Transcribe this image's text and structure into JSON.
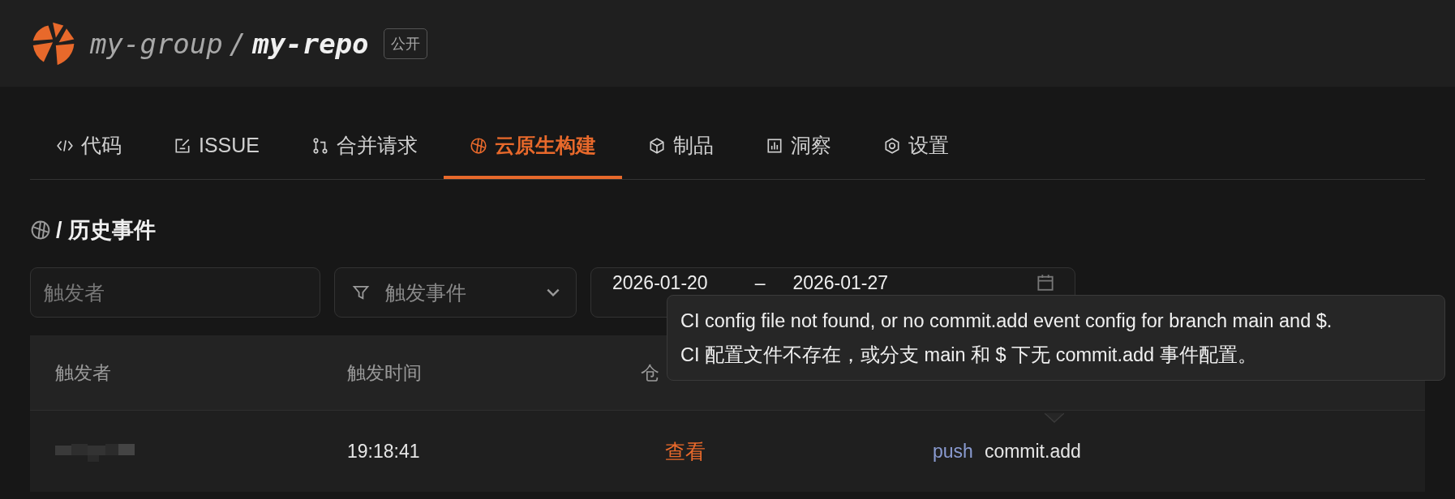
{
  "header": {
    "group": "my-group",
    "separator": "/",
    "repo": "my-repo",
    "visibility": "公开"
  },
  "tabs": [
    {
      "label": "代码",
      "selected": false
    },
    {
      "label": "ISSUE",
      "selected": false
    },
    {
      "label": "合并请求",
      "selected": false
    },
    {
      "label": "云原生构建",
      "selected": true
    },
    {
      "label": "制品",
      "selected": false
    },
    {
      "label": "洞察",
      "selected": false
    },
    {
      "label": "设置",
      "selected": false
    }
  ],
  "breadcrumb": {
    "text": "/ 历史事件"
  },
  "filters": {
    "trigger_user": {
      "placeholder": "触发者"
    },
    "event": {
      "placeholder": "触发事件"
    },
    "date_range": {
      "start": "2026-01-20",
      "separator": "–",
      "end": "2026-01-27"
    }
  },
  "table": {
    "columns": [
      "触发者",
      "触发时间",
      "仓"
    ],
    "rows": [
      {
        "time": "19:18:41",
        "link": "查看",
        "event_type": "push",
        "event": "commit.add"
      }
    ]
  },
  "tooltip": {
    "text": "CI config file not found, or no commit.add event config for branch main and $. CI 配置文件不存在，或分支 main 和 $ 下无 commit.add 事件配置。"
  }
}
